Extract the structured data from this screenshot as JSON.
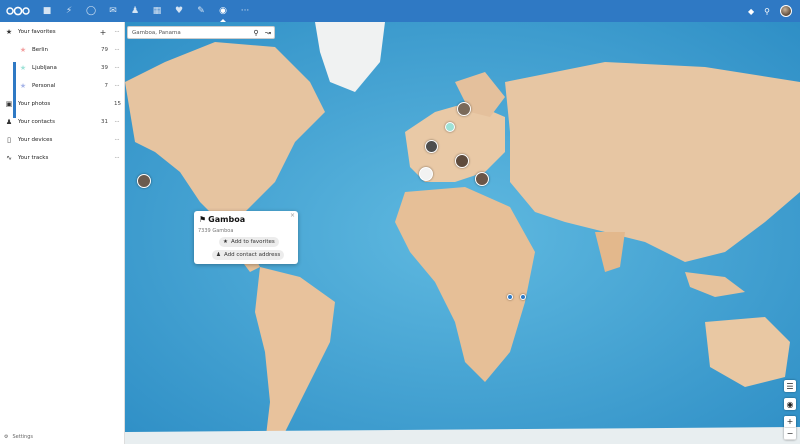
{
  "header": {
    "nav_icons": [
      "files-icon",
      "activity-icon",
      "talk-icon",
      "mail-icon",
      "contacts-icon",
      "calendar-icon",
      "favorites-icon",
      "notes-icon",
      "maps-icon",
      "more-icon"
    ],
    "active_app": "maps-icon"
  },
  "sidebar": {
    "favorites_label": "Your favorites",
    "favorites": [
      {
        "label": "Berlin",
        "count": "79",
        "color": "#f3a0a0"
      },
      {
        "label": "Ljubljana",
        "count": "39",
        "color": "#9fe3d8"
      },
      {
        "label": "Personal",
        "count": "7",
        "color": "#a7b5e8"
      }
    ],
    "photos_label": "Your photos",
    "photos_count": "15",
    "contacts_label": "Your contacts",
    "contacts_count": "31",
    "devices_label": "Your devices",
    "tracks_label": "Your tracks",
    "settings_label": "Settings"
  },
  "search": {
    "value": "Gamboa, Panama"
  },
  "popup": {
    "title": "Gamboa",
    "address": "7339 Gamboa",
    "add_favorite": "Add to favorites",
    "add_contact": "Add contact address"
  },
  "colors": {
    "header": "#2f79c4",
    "ocean": "#46a6d6",
    "land": "#e8c9a8"
  }
}
